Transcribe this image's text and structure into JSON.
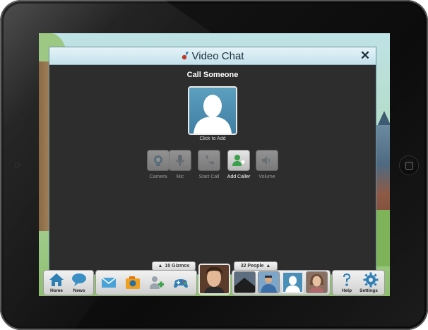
{
  "window": {
    "title": "Video Chat",
    "close_glyph": "✕",
    "heading": "Call Someone",
    "add_contact_label": "Click to Add"
  },
  "controls": [
    {
      "label": "Camera",
      "icon": "camera-icon",
      "enabled": false
    },
    {
      "label": "Mic",
      "icon": "mic-icon",
      "enabled": false
    },
    {
      "label": "Start Call",
      "icon": "phone-icon",
      "enabled": false
    },
    {
      "label": "Add Caller",
      "icon": "add-person-icon",
      "enabled": true
    },
    {
      "label": "Volume",
      "icon": "volume-icon",
      "enabled": false
    }
  ],
  "toolbar": {
    "home_label": "Home",
    "news_label": "News",
    "help_label": "Help",
    "settings_label": "Settings",
    "gizmos_tab": "10 Gizmos",
    "people_tab": "32 People",
    "tab_arrow": "▲"
  },
  "colors": {
    "window_bg": "#2d2d2d",
    "titlebar": "#d6ecf3",
    "accent_blue": "#4a8fb8",
    "add_green": "#3aa04a"
  }
}
